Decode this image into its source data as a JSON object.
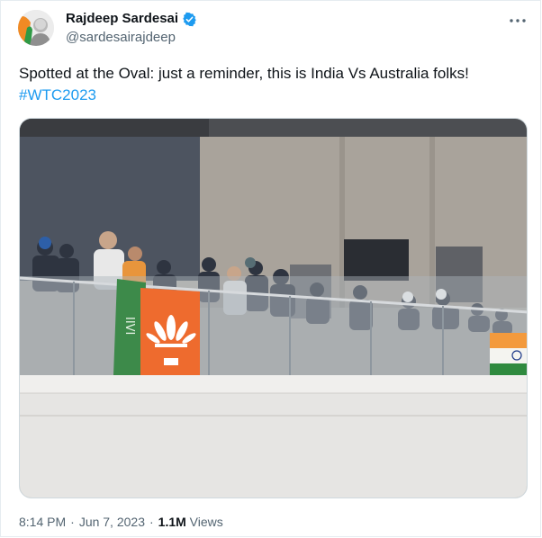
{
  "author": {
    "display_name": "Rajdeep Sardesai",
    "handle": "@sardesairajdeep",
    "verified_color": "#1d9bf0"
  },
  "tweet": {
    "text": "Spotted at the Oval: just a reminder, this is India Vs Australia folks!",
    "hashtag": "#WTC2023"
  },
  "meta": {
    "time": "8:14 PM",
    "separator": "·",
    "date": "Jun 7, 2023",
    "views_count": "1.1M",
    "views_label": "Views"
  },
  "icons": {
    "more": "more-options-icon",
    "verified": "verified-badge-icon"
  },
  "media": {
    "flag_text": "IIVI"
  }
}
